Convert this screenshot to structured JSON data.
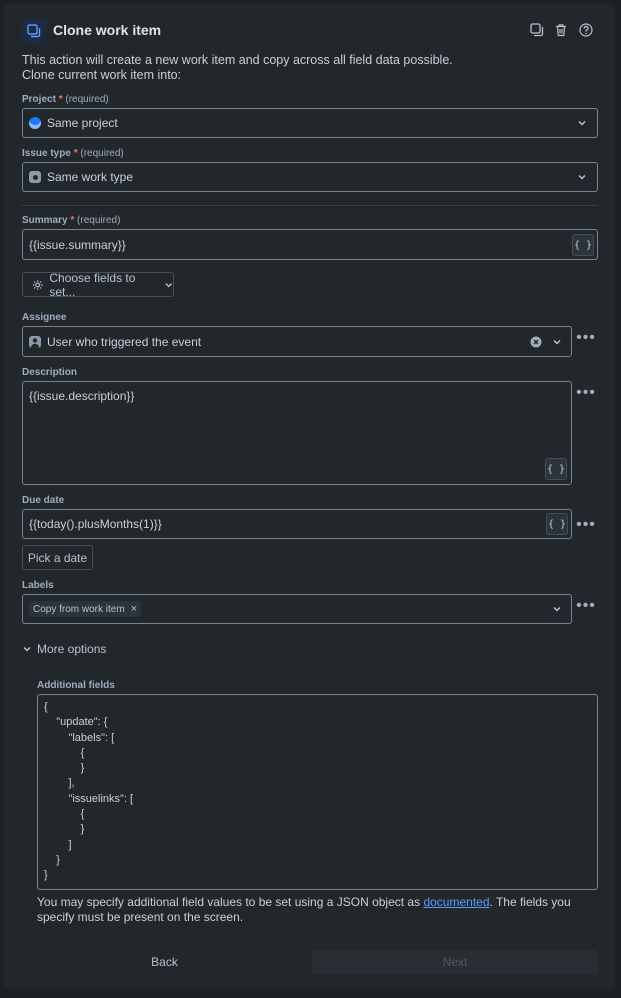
{
  "header": {
    "title": "Clone work item",
    "icons": [
      "copy-icon",
      "trash-icon",
      "help-icon"
    ]
  },
  "intro": {
    "line1": "This action will create a new work item and copy across all field data possible.",
    "line2": "Clone current work item into:"
  },
  "required_text": "(required)",
  "project": {
    "label": "Project",
    "value": "Same project"
  },
  "issue_type": {
    "label": "Issue type",
    "value": "Same work type"
  },
  "summary": {
    "label": "Summary",
    "value": "{{issue.summary}}"
  },
  "choose_fields": {
    "label": "Choose fields to set..."
  },
  "assignee": {
    "label": "Assignee",
    "value": "User who triggered the event"
  },
  "description": {
    "label": "Description",
    "value": "{{issue.description}}"
  },
  "due_date": {
    "label": "Due date",
    "value": "{{today().plusMonths(1)}}",
    "pick_label": "Pick a date"
  },
  "labels": {
    "label": "Labels",
    "tag": "Copy from work item"
  },
  "more_options": {
    "label": "More options"
  },
  "additional_fields": {
    "label": "Additional fields",
    "lines": [
      "{",
      "    \"update\": {",
      "        \"labels\": [",
      "            {",
      "            }",
      "        ],",
      "        \"issuelinks\": [",
      "            {",
      "            }",
      "        ]",
      "    }",
      "}"
    ]
  },
  "help": {
    "before": "You may specify additional field values to be set using a JSON object as ",
    "link": "documented",
    "after": ". The fields you specify must be present on the screen."
  },
  "footer": {
    "back": "Back",
    "next": "Next"
  },
  "colors": {
    "background": "#22272b",
    "border": "#738496",
    "required_star": "#f87168",
    "link": "#579dff"
  }
}
